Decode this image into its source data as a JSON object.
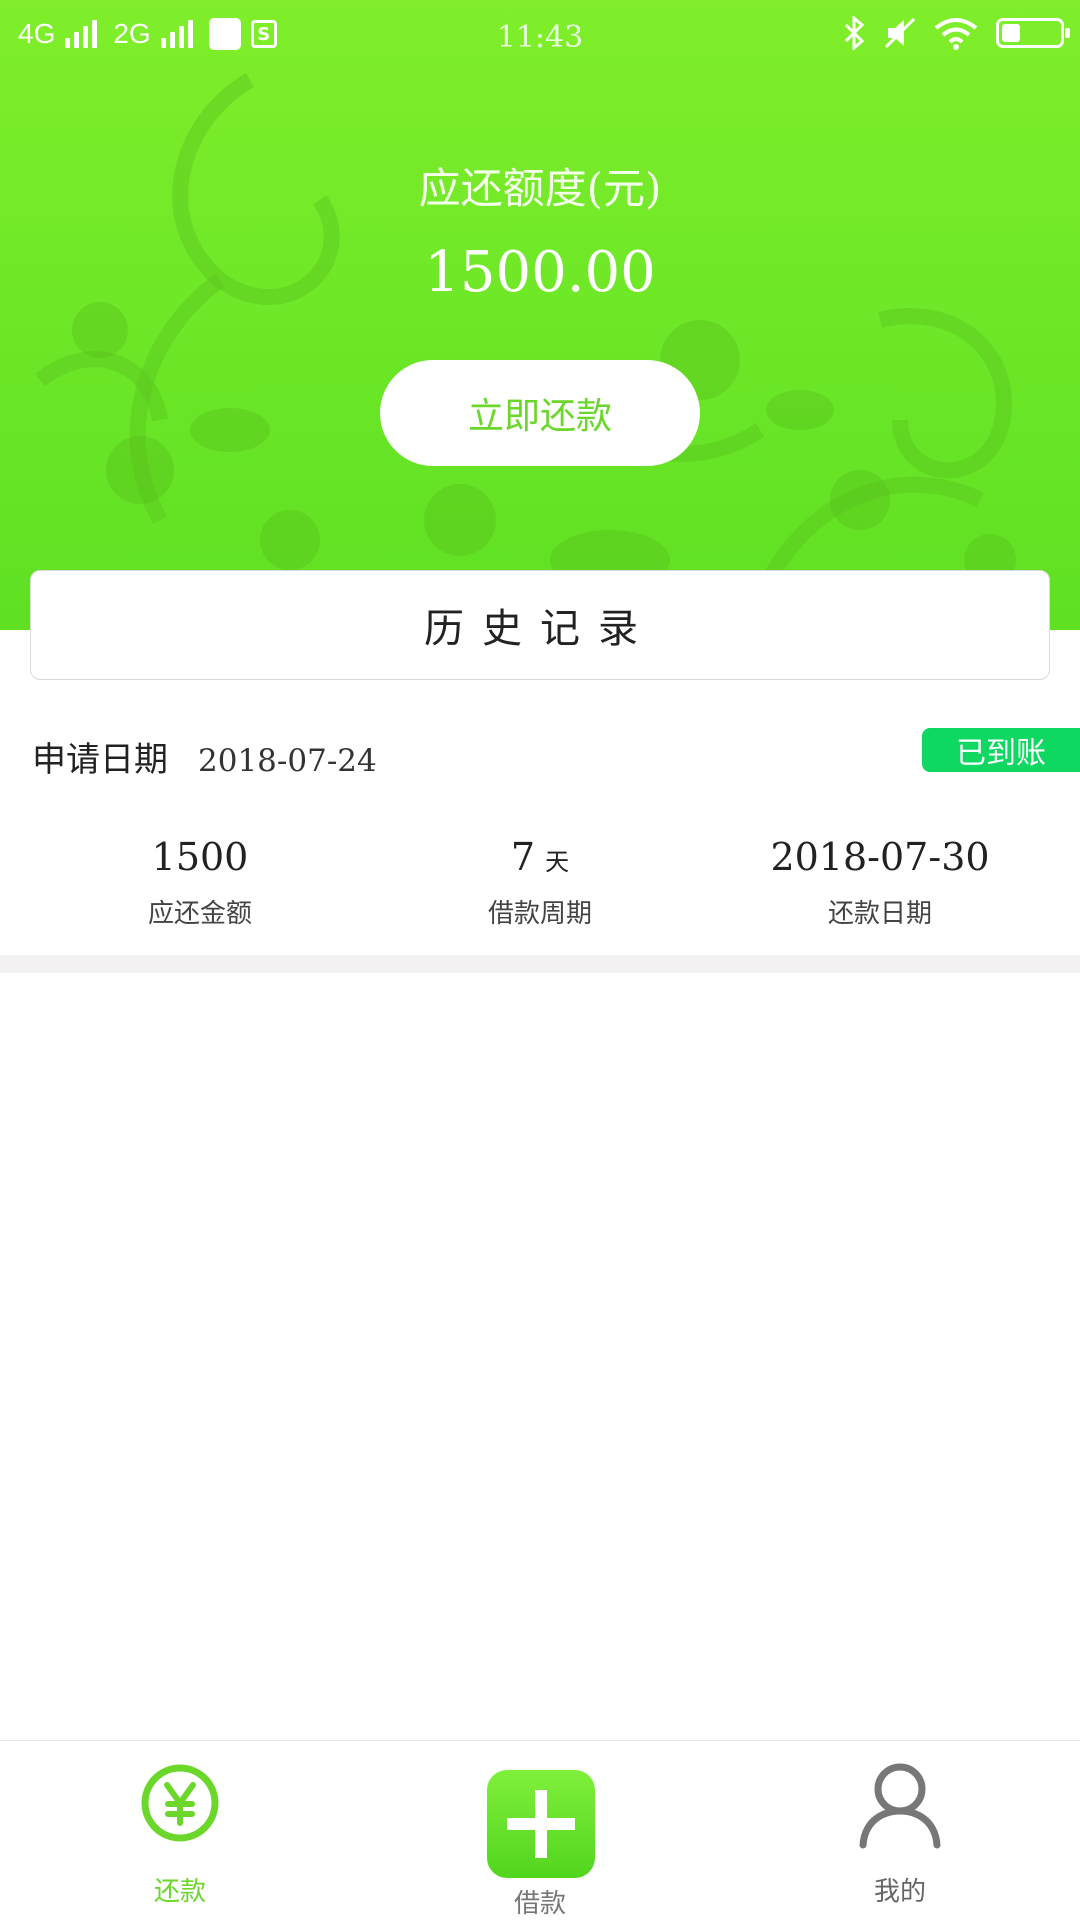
{
  "status_bar": {
    "network_1": "4G",
    "network_2": "2G",
    "time": "11:43",
    "icons": [
      "signal-icon",
      "shopping-bag-icon",
      "s-app-icon",
      "bluetooth-icon",
      "mute-icon",
      "wifi-icon",
      "battery-icon"
    ]
  },
  "header": {
    "label": "应还额度(元)",
    "amount": "1500.00",
    "repay_button": "立即还款"
  },
  "history": {
    "title": "历史记录"
  },
  "record": {
    "apply_label": "申请日期",
    "apply_date": "2018-07-24",
    "status": "已到账",
    "amount_value": "1500",
    "amount_label": "应还金额",
    "period_value": "7",
    "period_unit": "天",
    "period_label": "借款周期",
    "due_value": "2018-07-30",
    "due_label": "还款日期"
  },
  "tabbar": {
    "tabs": [
      {
        "label": "还款",
        "icon": "yuan-circle-icon",
        "active": true
      },
      {
        "label": "借款",
        "icon": "plus-icon",
        "active": false
      },
      {
        "label": "我的",
        "icon": "user-icon",
        "active": false
      }
    ]
  },
  "colors": {
    "primary_green": "#6ae627",
    "badge_green": "#0fd862",
    "active_tab": "#6bd72b"
  }
}
